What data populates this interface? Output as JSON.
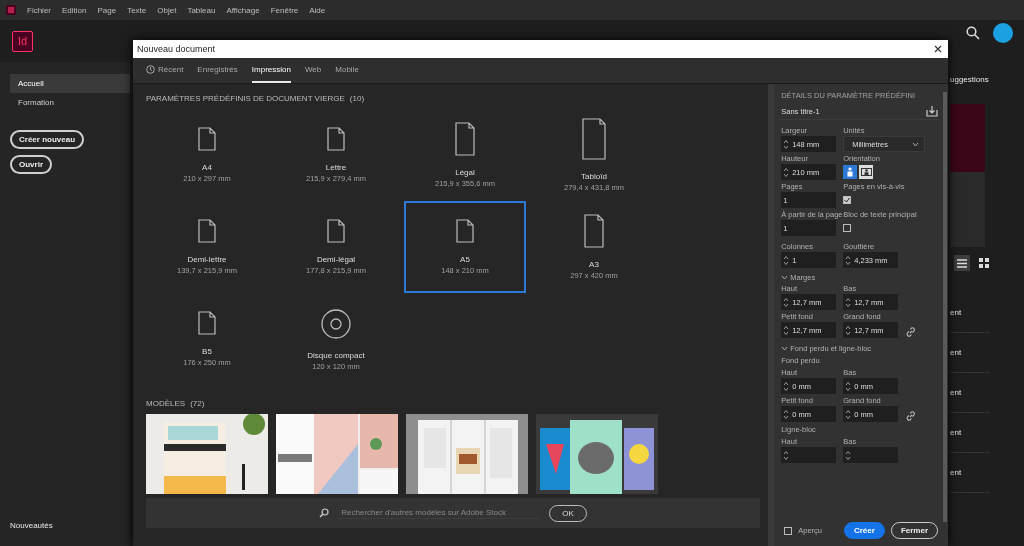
{
  "menu_bar": {
    "items": [
      "Fichier",
      "Edition",
      "Page",
      "Texte",
      "Objet",
      "Tableau",
      "Affichage",
      "Fenêtre",
      "Aide"
    ]
  },
  "app": {
    "logo": "Id"
  },
  "sidebar": {
    "items": [
      {
        "label": "Accueil",
        "selected": true
      },
      {
        "label": "Formation",
        "selected": false
      }
    ],
    "buttons": [
      "Créer nouveau",
      "Ouvrir"
    ],
    "footer": "Nouveautés"
  },
  "background_panel": {
    "heading": "uggestions",
    "views": [
      {
        "kind": "list",
        "selected": true
      },
      {
        "kind": "grid",
        "selected": false
      }
    ],
    "rows": [
      "ent",
      "ent",
      "ent",
      "ent",
      "ent"
    ]
  },
  "dialog": {
    "title": "Nouveau document",
    "tabs": [
      {
        "label": "Récent",
        "selected": false,
        "has_icon": true
      },
      {
        "label": "Enregistrés",
        "selected": false,
        "has_icon": false
      },
      {
        "label": "Impression",
        "selected": true,
        "has_icon": false
      },
      {
        "label": "Web",
        "selected": false,
        "has_icon": false
      },
      {
        "label": "Mobile",
        "selected": false,
        "has_icon": false
      }
    ],
    "presets": {
      "heading": "PARAMÈTRES PRÉDÉFINIS DE DOCUMENT VIERGE",
      "count": "(10)",
      "items": [
        {
          "name": "A4",
          "size": "210 x 297 mm",
          "kind": "page",
          "selected": false
        },
        {
          "name": "Lettre",
          "size": "215,9 x 279,4 mm",
          "kind": "page",
          "selected": false
        },
        {
          "name": "Légal",
          "size": "215,9 x 355,6 mm",
          "kind": "tall",
          "selected": false
        },
        {
          "name": "Tabloïd",
          "size": "279,4 x 431,8 mm",
          "kind": "large",
          "selected": false
        },
        {
          "name": "Demi-lettre",
          "size": "139,7 x 215,9 mm",
          "kind": "page",
          "selected": false
        },
        {
          "name": "Demi-légal",
          "size": "177,8 x 215,9 mm",
          "kind": "page",
          "selected": false
        },
        {
          "name": "A5",
          "size": "148 x 210 mm",
          "kind": "page",
          "selected": true
        },
        {
          "name": "A3",
          "size": "297 x 420 mm",
          "kind": "tall",
          "selected": false
        },
        {
          "name": "B5",
          "size": "176 x 250 mm",
          "kind": "page",
          "selected": false
        },
        {
          "name": "Disque compact",
          "size": "120 x 120 mm",
          "kind": "disc",
          "selected": false
        }
      ]
    },
    "templates": {
      "heading": "MODÈLES",
      "count": "(72)"
    },
    "search": {
      "placeholder": "Rechercher d'autres modèles sur Adobe Stock",
      "button": "OK"
    },
    "details": {
      "heading": "DÉTAILS DU PARAMÈTRE PRÉDÉFINI",
      "name": "Sans titre-1",
      "width": {
        "label": "Largeur",
        "value": "148 mm"
      },
      "units": {
        "label": "Unités",
        "value": "Millimètres"
      },
      "height": {
        "label": "Hauteur",
        "value": "210 mm"
      },
      "orientation": {
        "label": "Orientation",
        "options": [
          {
            "kind": "portrait",
            "selected": true
          },
          {
            "kind": "landscape",
            "selected": false
          }
        ]
      },
      "pages": {
        "label": "Pages",
        "value": "1"
      },
      "facing": {
        "label": "Pages en vis-à-vis",
        "checked": true
      },
      "start_page": {
        "label": "À partir de la page",
        "value": "1"
      },
      "primary_frame": {
        "label": "Bloc de texte principal",
        "checked": false
      },
      "columns": {
        "label": "Colonnes",
        "value": "1"
      },
      "gutter": {
        "label": "Gouttière",
        "value": "4,233 mm"
      },
      "margins": {
        "label": "Marges",
        "expanded": true,
        "fields": [
          {
            "label": "Haut",
            "value": "12,7 mm"
          },
          {
            "label": "Bas",
            "value": "12,7 mm"
          },
          {
            "label": "Petit fond",
            "value": "12,7 mm"
          },
          {
            "label": "Grand fond",
            "value": "12,7 mm"
          }
        ]
      },
      "bleed": {
        "label": "Fond perdu et ligne-bloc",
        "expanded": true,
        "sections": [
          {
            "label": "Fond perdu",
            "fields": [
              {
                "label": "Haut",
                "value": "0 mm"
              },
              {
                "label": "Bas",
                "value": "0 mm"
              },
              {
                "label": "Petit fond",
                "value": "0 mm"
              },
              {
                "label": "Grand fond",
                "value": "0 mm"
              }
            ]
          },
          {
            "label": "Ligne-bloc",
            "fields": [
              {
                "label": "Haut"
              },
              {
                "label": "Bas"
              }
            ]
          }
        ]
      },
      "preview": {
        "label": "Aperçu",
        "checked": false
      },
      "buttons": [
        {
          "label": "Créer",
          "kind": "primary"
        },
        {
          "label": "Fermer",
          "kind": "secondary"
        }
      ]
    }
  }
}
